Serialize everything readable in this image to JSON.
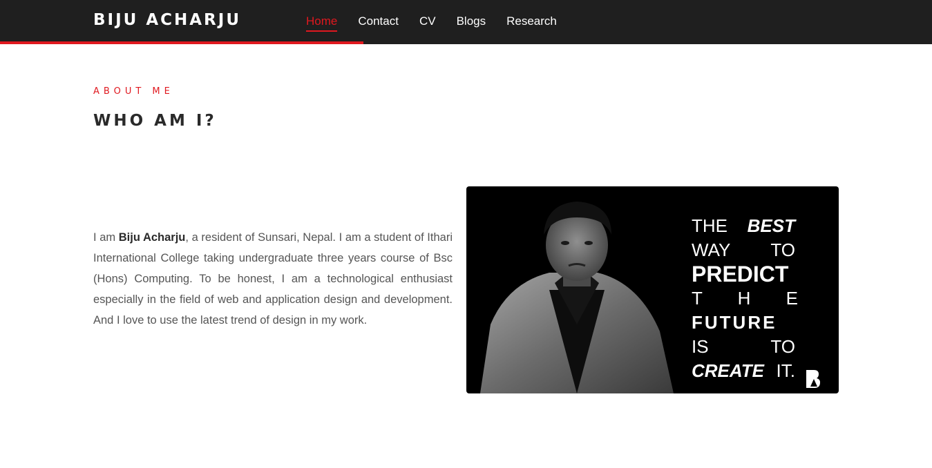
{
  "header": {
    "brand": "BIJU ACHARJU",
    "nav": [
      {
        "label": "Home",
        "active": true
      },
      {
        "label": "Contact",
        "active": false
      },
      {
        "label": "CV",
        "active": false
      },
      {
        "label": "Blogs",
        "active": false
      },
      {
        "label": "Research",
        "active": false
      }
    ],
    "scroll_progress_percent": 39,
    "colors": {
      "bar": "#1f1f1f",
      "accent": "#e0181f"
    }
  },
  "about": {
    "kicker": "ABOUT ME",
    "title": "WHO AM I?",
    "bio": {
      "intro": "I am ",
      "name": "Biju Acharju",
      "rest": ", a resident of Sunsari, Nepal. I am a student of Ithari International College taking undergraduate three years course of Bsc (Hons) Computing. To be honest, I am a technological enthusiast especially in the field of web and application design and development. And I love to use the latest trend of design in my work."
    }
  },
  "banner": {
    "quote": {
      "l1a": "THE",
      "l1b": "BEST",
      "l2a": "WAY",
      "l2b": "TO",
      "l3": "PREDICT",
      "l4": "T H E",
      "l5": "FUTURE",
      "l6a": "IS",
      "l6b": "TO",
      "l7a": "CREATE",
      "l7b": "IT."
    },
    "logo_icon": "ba-monogram-icon",
    "portrait_icon": "portrait-photo"
  }
}
